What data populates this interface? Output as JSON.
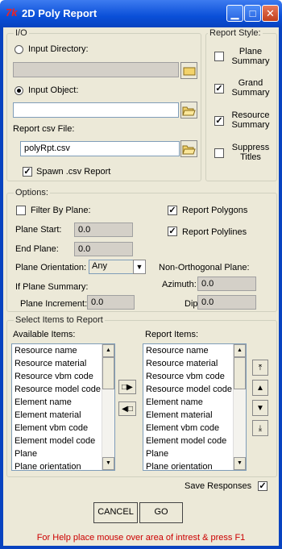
{
  "title_bar": {
    "app_icon": "7k",
    "title": "2D Poly Report"
  },
  "io": {
    "legend": "I/O",
    "input_directory": {
      "label": "Input Directory:",
      "value": ""
    },
    "input_object": {
      "label": "Input Object:",
      "value": ""
    },
    "report_csv": {
      "label": "Report csv File:",
      "value": "polyRpt.csv"
    },
    "spawn": {
      "label": "Spawn .csv Report",
      "checked": true
    }
  },
  "report_style": {
    "legend": "Report Style:",
    "plane_summary": "Plane\nSummary",
    "grand_summary": "Grand\nSummary",
    "resource_summary": "Resource\nSummary",
    "suppress_titles": "Suppress\nTitles"
  },
  "options": {
    "legend": "Options:",
    "filter_by_plane": "Filter By Plane:",
    "report_polygons": "Report Polygons",
    "report_polylines": "Report Polylines",
    "plane_start_label": "Plane Start:",
    "plane_start": "0.0",
    "end_plane_label": "End Plane:",
    "end_plane": "0.0",
    "plane_orientation_label": "Plane Orientation:",
    "plane_orientation": "Any",
    "non_orth": "Non-Orthogonal Plane:",
    "if_plane_summary": "If Plane Summary:",
    "azimuth_label": "Azimuth:",
    "azimuth": "0.0",
    "plane_increment_label": "Plane Increment:",
    "plane_increment": "0.0",
    "dip_label": "Dip:",
    "dip": "0.0"
  },
  "select_items": {
    "legend": "Select Items to Report",
    "available_label": "Available Items:",
    "report_label": "Report Items:",
    "available": [
      "Resource name",
      "Resource material",
      "Resource vbm code",
      "Resource model code",
      "Element name",
      "Element material",
      "Element vbm code",
      "Element model code",
      "Plane",
      "Plane orientation"
    ],
    "report": [
      "Resource name",
      "Resource material",
      "Resource vbm code",
      "Resource model code",
      "Element name",
      "Element material",
      "Element vbm code",
      "Element model code",
      "Plane",
      "Plane orientation"
    ]
  },
  "footer": {
    "save_responses": "Save Responses",
    "cancel": "CANCEL",
    "go": "GO",
    "help": "For Help place mouse over area of intrest & press F1"
  },
  "colors": {
    "help_text": "#cc0000",
    "title_bar": "#0a4fd8",
    "dialog_bg": "#ece9d8"
  }
}
